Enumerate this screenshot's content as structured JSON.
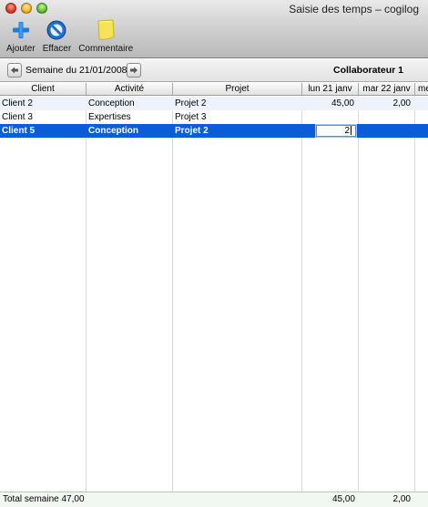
{
  "window": {
    "title": "Saisie des temps – cogilog"
  },
  "toolbar": {
    "add_label": "Ajouter",
    "delete_label": "Effacer",
    "comment_label": "Commentaire"
  },
  "nav": {
    "week_label": "Semaine du 21/01/2008",
    "collaborator": "Collaborateur 1"
  },
  "table": {
    "headers": [
      "Client",
      "Activité",
      "Projet",
      "lun 21 janv",
      "mar 22 janv",
      "me"
    ],
    "rows": [
      {
        "client": "Client 2",
        "activity": "Conception",
        "project": "Projet 2",
        "mon": "45,00",
        "tue": "2,00",
        "wed": ""
      },
      {
        "client": "Client 3",
        "activity": "Expertises",
        "project": "Projet 3",
        "mon": "",
        "tue": "",
        "wed": ""
      },
      {
        "client": "Client 5",
        "activity": "Conception",
        "project": "Projet 2",
        "mon": "2",
        "tue": "",
        "wed": ""
      }
    ],
    "selected_row": 2
  },
  "footer": {
    "total_label": "Total semaine 47,00",
    "mon_total": "45,00",
    "tue_total": "2,00"
  },
  "colors": {
    "selection": "#0a5dd8",
    "add_icon": "#1a7de0",
    "delete_icon": "#1d6fd1",
    "comment_icon": "#f6e25a"
  },
  "icons": {
    "add": "plus-icon",
    "delete": "no-entry-icon",
    "comment": "sticky-note-icon",
    "prev": "arrow-left-icon",
    "next": "arrow-right-icon"
  }
}
